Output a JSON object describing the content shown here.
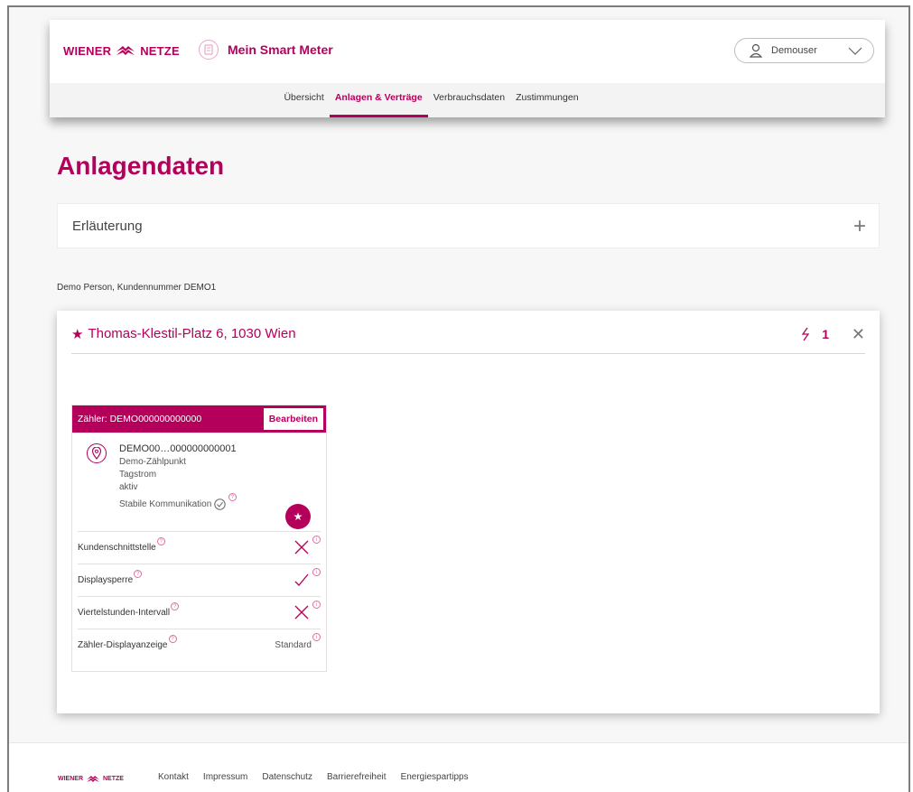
{
  "header": {
    "brand_left": "WIENER",
    "brand_right": "NETZE",
    "app_title": "Mein Smart Meter",
    "user_name": "Demouser"
  },
  "nav": {
    "items": [
      {
        "label": "Übersicht"
      },
      {
        "label": "Anlagen & Verträge"
      },
      {
        "label": "Verbrauchsdaten"
      },
      {
        "label": "Zustimmungen"
      }
    ],
    "active_index": 1
  },
  "page": {
    "title": "Anlagendaten",
    "accordion_label": "Erläuterung",
    "customer_line": "Demo Person, Kundennummer DEMO1"
  },
  "site": {
    "address": "Thomas-Klestil-Platz 6, 1030 Wien",
    "meter_count": "1"
  },
  "meter": {
    "header_label": "Zähler: DEMO000000000000",
    "edit_label": "Bearbeiten",
    "metering_point_id": "DEMO00…000000000001",
    "metering_point_name": "Demo-Zählpunkt",
    "tariff": "Tagstrom",
    "status": "aktiv",
    "communication": "Stabile Kommunikation",
    "rows": [
      {
        "label": "Kundenschnittstelle",
        "value": "cross"
      },
      {
        "label": "Displaysperre",
        "value": "check"
      },
      {
        "label": "Viertelstunden-Intervall",
        "value": "cross"
      },
      {
        "label": "Zähler-Displayanzeige",
        "value": "Standard"
      }
    ]
  },
  "footer": {
    "brand_left": "WIENER",
    "brand_right": "NETZE",
    "links": [
      "Kontakt",
      "Impressum",
      "Datenschutz",
      "Barrierefreiheit",
      "Energiespartipps"
    ]
  },
  "colors": {
    "brand": "#b5005b"
  }
}
